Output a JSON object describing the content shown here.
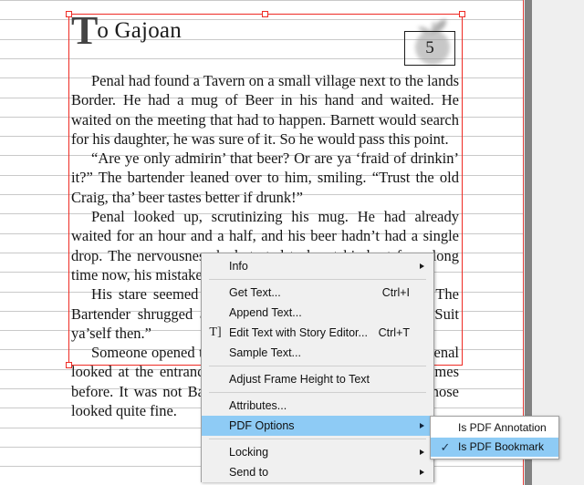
{
  "document": {
    "title_dropcap": "T",
    "title_rest": "o Gajoan",
    "page_number": "5",
    "paragraphs": [
      "Penal had found a Tavern on a small village next to the lands Border. He had a mug of Beer in his hand and waited. He waited on the meeting that had to happen. Barnett would search for his daughter, he was sure of it. So he would pass this point.",
      "“Are ye only admirin’ that beer? Or are ya ‘fraid of drinkin’ it?” The bartender leaned over to him, smiling. “Trust the old Craig, tha’ beer tastes better if drunk!”",
      "Penal looked up, scrutinizing his mug. He had already waited for an hour and a half, and his beer hadn’t had a single drop. The nervousness had started to be at his best for a long time now, his mistake and he lost.",
      "His stare seemed to be enough for the Barkeep boss. The Bartender shrugged and turned to the other customers. “Suit ya’self then.”",
      "Someone opened the door, the fifth guest on that hour. Penal looked at the entrance, like he had done that thirty-one times before. It was not Barnett. His head was bruised and his nose looked quite fine."
    ]
  },
  "context_menu": {
    "items": [
      {
        "label": "Info",
        "accel": "",
        "arrow": true,
        "selected": false,
        "icon": ""
      },
      {
        "separator": true
      },
      {
        "label": "Get Text...",
        "accel": "Ctrl+I",
        "arrow": false,
        "selected": false,
        "icon": ""
      },
      {
        "label": "Append Text...",
        "accel": "",
        "arrow": false,
        "selected": false,
        "icon": ""
      },
      {
        "label": "Edit Text with Story Editor...",
        "accel": "Ctrl+T",
        "arrow": false,
        "selected": false,
        "icon": "text-cursor-icon"
      },
      {
        "label": "Sample Text...",
        "accel": "",
        "arrow": false,
        "selected": false,
        "icon": ""
      },
      {
        "separator": true
      },
      {
        "label": "Adjust Frame Height to Text",
        "accel": "",
        "arrow": false,
        "selected": false,
        "icon": ""
      },
      {
        "separator": true
      },
      {
        "label": "Attributes...",
        "accel": "",
        "arrow": false,
        "selected": false,
        "icon": ""
      },
      {
        "label": "PDF Options",
        "accel": "",
        "arrow": true,
        "selected": true,
        "icon": ""
      },
      {
        "separator": true
      },
      {
        "label": "Locking",
        "accel": "",
        "arrow": true,
        "selected": false,
        "icon": ""
      },
      {
        "label": "Send to",
        "accel": "",
        "arrow": true,
        "selected": false,
        "icon": ""
      }
    ]
  },
  "submenu": {
    "items": [
      {
        "label": "Is PDF Annotation",
        "checked": false,
        "selected": false
      },
      {
        "label": "Is PDF Bookmark",
        "checked": true,
        "selected": true
      }
    ],
    "check_glyph": "✓"
  },
  "colors": {
    "frame_red": "#ee2b24",
    "menu_highlight": "#8ecbf5",
    "menu_bg": "#f0f0f0",
    "submenu_bg": "#ffffff",
    "guide_line": "#c9c9c9",
    "canvas_bg": "#ffffff",
    "workspace_bg": "#efefef",
    "page_shadow": "#828282"
  }
}
